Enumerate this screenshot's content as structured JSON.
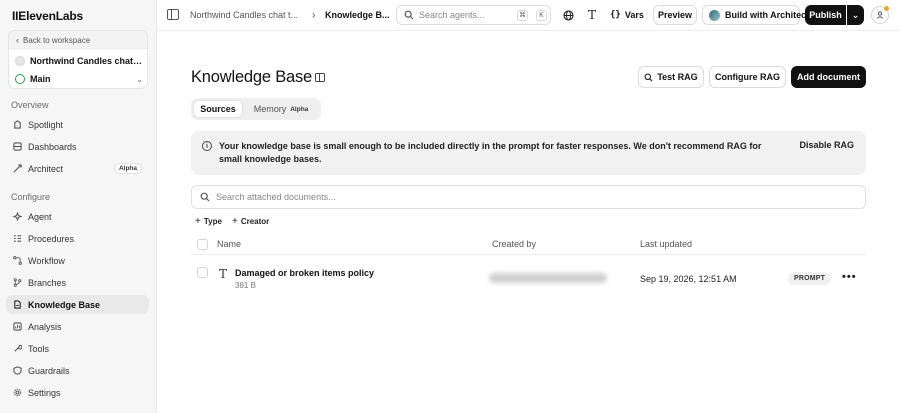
{
  "brand": {
    "logo": "IIElevenLabs"
  },
  "workspace": {
    "back_label": "Back to workspace",
    "agent_name": "Northwind Candles chat t...",
    "branch_name": "Main"
  },
  "sidebar": {
    "overview_label": "Overview",
    "configure_label": "Configure",
    "overview_items": [
      {
        "label": "Spotlight",
        "icon": "spotlight-icon"
      },
      {
        "label": "Dashboards",
        "icon": "dashboards-icon"
      },
      {
        "label": "Architect",
        "icon": "architect-icon",
        "badge": "Alpha"
      }
    ],
    "configure_items": [
      {
        "label": "Agent",
        "icon": "agent-icon"
      },
      {
        "label": "Procedures",
        "icon": "procedures-icon"
      },
      {
        "label": "Workflow",
        "icon": "workflow-icon"
      },
      {
        "label": "Branches",
        "icon": "branches-icon"
      },
      {
        "label": "Knowledge Base",
        "icon": "knowledge-base-icon",
        "active": true
      },
      {
        "label": "Analysis",
        "icon": "analysis-icon"
      },
      {
        "label": "Tools",
        "icon": "tools-icon"
      },
      {
        "label": "Guardrails",
        "icon": "guardrails-icon"
      },
      {
        "label": "Settings",
        "icon": "settings-icon"
      }
    ]
  },
  "topbar": {
    "breadcrumb_agent": "Northwind Candles chat t...",
    "breadcrumb_separator": "›",
    "breadcrumb_current": "Knowledge B...",
    "search_placeholder": "Search agents...",
    "kbd_cmd": "⌘",
    "kbd_k": "K",
    "vars_label": "Vars",
    "preview_label": "Preview",
    "architect_label": "Build with Architect",
    "publish_label": "Publish"
  },
  "main": {
    "title": "Knowledge Base",
    "test_rag_label": "Test RAG",
    "configure_rag_label": "Configure RAG",
    "add_document_label": "Add document",
    "tabs": [
      {
        "label": "Sources",
        "active": true
      },
      {
        "label": "Memory",
        "chip": "Alpha"
      }
    ],
    "banner": {
      "text": "Your knowledge base is small enough to be included directly in the prompt for faster responses. We don't recommend RAG for small knowledge bases.",
      "action": "Disable RAG"
    },
    "doc_search_placeholder": "Search attached documents...",
    "filters": [
      "Type",
      "Creator"
    ],
    "table": {
      "headers": [
        "Name",
        "Created by",
        "Last updated"
      ],
      "rows": [
        {
          "name": "Damaged or broken items policy",
          "size": "381 B",
          "updated": "Sep 19, 2026, 12:51 AM",
          "badge": "PROMPT"
        }
      ]
    }
  },
  "colors": {
    "accent_dark": "#111111",
    "branch_green": "#2a9d4b",
    "notification": "#f5a524"
  }
}
